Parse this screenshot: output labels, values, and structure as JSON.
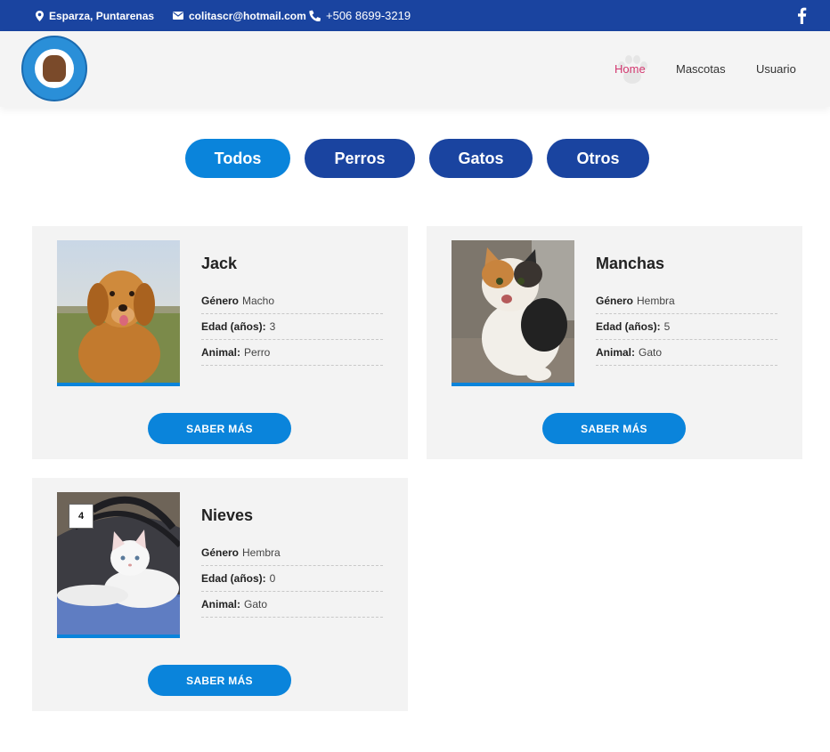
{
  "topbar": {
    "location": "Esparza, Puntarenas",
    "email": "colitascr@hotmail.com",
    "phone": "+506 8699-3219"
  },
  "nav": {
    "home": "Home",
    "mascotas": "Mascotas",
    "usuario": "Usuario"
  },
  "filters": {
    "todos": "Todos",
    "perros": "Perros",
    "gatos": "Gatos",
    "otros": "Otros"
  },
  "labels": {
    "genero": "Género",
    "edad": "Edad (años):",
    "animal": "Animal:",
    "more": "SABER MÁS"
  },
  "pets": [
    {
      "name": "Jack",
      "genero": "Macho",
      "edad": "3",
      "animal": "Perro"
    },
    {
      "name": "Manchas",
      "genero": "Hembra",
      "edad": "5",
      "animal": "Gato"
    },
    {
      "name": "Nieves",
      "genero": "Hembra",
      "edad": "0",
      "animal": "Gato",
      "badge": "4"
    }
  ],
  "colors": {
    "topbar": "#1a44a0",
    "accent": "#0a84db",
    "active_nav": "#d2366e"
  },
  "icons": {
    "location": "map-pin-icon",
    "email": "envelope-icon",
    "phone": "phone-icon",
    "social": "facebook-icon"
  }
}
